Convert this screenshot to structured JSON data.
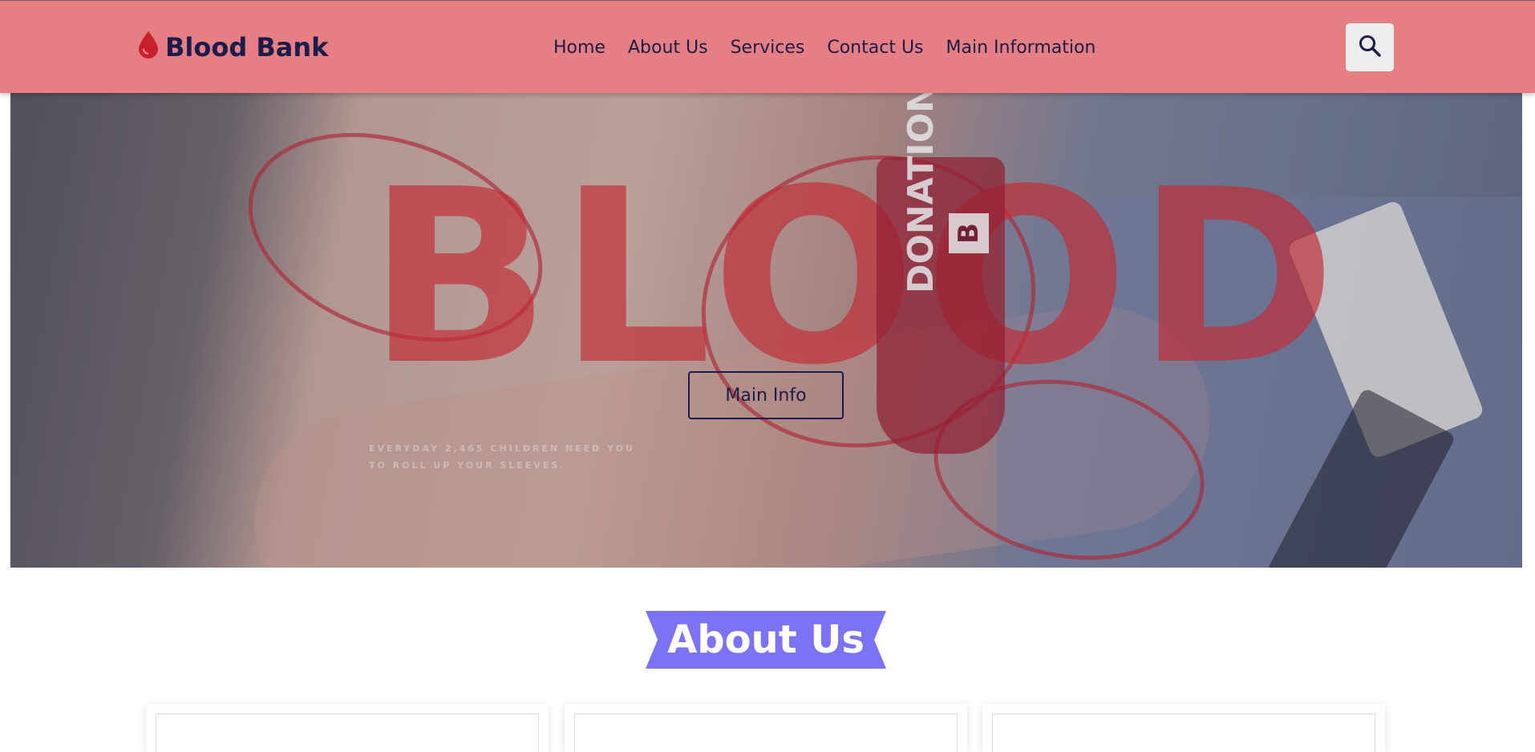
{
  "header": {
    "brand": "Blood Bank",
    "brand_icon": "blood-drop-icon",
    "brand_color": "#c8202e",
    "background": "#e57f83",
    "nav": [
      {
        "label": "Home"
      },
      {
        "label": "About Us"
      },
      {
        "label": "Services"
      },
      {
        "label": "Contact Us"
      },
      {
        "label": "Main Information"
      }
    ],
    "search_icon": "search-icon"
  },
  "hero": {
    "watermark": "BLOOD",
    "bag_label": "DONATION",
    "bag_letter": "B",
    "tagline": "Everyday 2,465 children need you to roll up your sleeves.",
    "button_label": "Main Info"
  },
  "about": {
    "title": "About Us",
    "ribbon_color": "#7b72f5",
    "card_count": 3
  }
}
